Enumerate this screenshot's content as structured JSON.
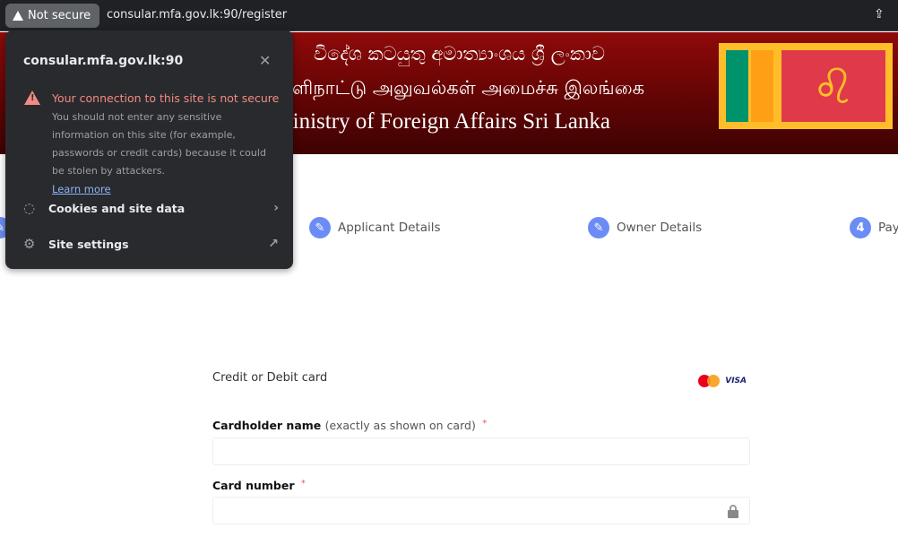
{
  "browser": {
    "security_chip": "Not secure",
    "url": "consular.mfa.gov.lk:90/register",
    "share_icon": "share-icon"
  },
  "banner": {
    "sinhala": "විදේශ කටයුතු අමාත්‍යාංශය ශ්‍රී ලංකාව",
    "tamil": "வெளிநாட்டு அலுவல்கள் அமைச்சு இலங்கை",
    "english": "Ministry of Foreign Affairs Sri Lanka",
    "sinhala_visible": "දේශ කටයුතු අමාත්‍යාංශය ශ්‍රී ලංකාව",
    "tamil_visible": "ாட்டு அலுவல்கள் அமைச்சு இலங்கை",
    "english_visible": "nistry of Foreign Affairs Sri Lanka"
  },
  "popup": {
    "host": "consular.mfa.gov.lk:90",
    "warning_title": "Your connection to this site is not secure",
    "warning_body": "You should not enter any sensitive information on this site (for example, passwords or credit cards) because it could be stolen by attackers.",
    "learn_more": "Learn more",
    "cookies": "Cookies and site data",
    "site_settings": "Site settings",
    "colors": {
      "bg": "#292a2d",
      "warning": "#f28b82",
      "link": "#8ab4f8"
    }
  },
  "steps": [
    {
      "label": "Applicant Details",
      "icon": "pencil-icon"
    },
    {
      "label": "Owner Details",
      "icon": "pencil-icon"
    },
    {
      "number": "4",
      "label": "Pay"
    }
  ],
  "form": {
    "title": "Credit or Debit card",
    "card_brands": [
      "Mastercard",
      "VISA"
    ],
    "visa_text": "VISA",
    "cardholder_label": "Cardholder name",
    "cardholder_hint": "(exactly as shown on card)",
    "required": "*",
    "cardholder_value": "",
    "card_number_label": "Card number",
    "card_number_value": ""
  },
  "colors": {
    "accent": "#6c8cf5",
    "banner": "#7a0606"
  }
}
